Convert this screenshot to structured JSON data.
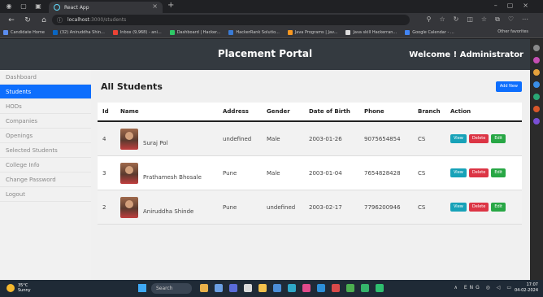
{
  "browser": {
    "tab_title": "React App",
    "url_host": "localhost",
    "url_path": ":3000/students",
    "bookmarks": [
      "Candidate Home",
      "(32) Aniruddha Shin...",
      "Inbox (9,968) - ani...",
      "Dashboard | Hacker...",
      "HackerRank Solutio...",
      "Java Programs | Jav...",
      "Java skill Hackerran...",
      "Google Calendar - ..."
    ],
    "other_favorites": "Other favorites"
  },
  "navbar": {
    "brand": "Placement Portal",
    "welcome": "Welcome ! Administrator"
  },
  "sidebar": {
    "items": [
      {
        "label": "Dashboard",
        "active": false
      },
      {
        "label": "Students",
        "active": true
      },
      {
        "label": "HODs",
        "active": false
      },
      {
        "label": "Companies",
        "active": false
      },
      {
        "label": "Openings",
        "active": false
      },
      {
        "label": "Selected Students",
        "active": false
      },
      {
        "label": "College Info",
        "active": false
      },
      {
        "label": "Change Password",
        "active": false
      },
      {
        "label": "Logout",
        "active": false
      }
    ]
  },
  "main": {
    "title": "All Students",
    "add_button": "Add New",
    "columns": [
      "Id",
      "Name",
      "Address",
      "Gender",
      "Date of Birth",
      "Phone",
      "Branch",
      "Action"
    ],
    "rows": [
      {
        "id": "4",
        "name": "Suraj Pol",
        "address": "undefined",
        "gender": "Male",
        "dob": "2003-01-26",
        "phone": "9075654854",
        "branch": "CS"
      },
      {
        "id": "3",
        "name": "Prathamesh Bhosale",
        "address": "Pune",
        "gender": "Male",
        "dob": "2003-01-04",
        "phone": "7654828428",
        "branch": "CS"
      },
      {
        "id": "2",
        "name": "Aniruddha Shinde",
        "address": "Pune",
        "gender": "undefined",
        "dob": "2003-02-17",
        "phone": "7796200946",
        "branch": "CS"
      }
    ],
    "actions": {
      "view": "View",
      "delete": "Delete",
      "edit": "Edit"
    }
  },
  "taskbar": {
    "weather_temp": "35°C",
    "weather_desc": "Sunny",
    "search": "Search",
    "lang": "ENG",
    "region": "IN",
    "time": "17:07",
    "date": "04-02-2024"
  },
  "colors": {
    "primary": "#0d6efd",
    "navbar": "#343a40",
    "view": "#17a2b8",
    "delete": "#dc3545",
    "edit": "#28a745"
  }
}
